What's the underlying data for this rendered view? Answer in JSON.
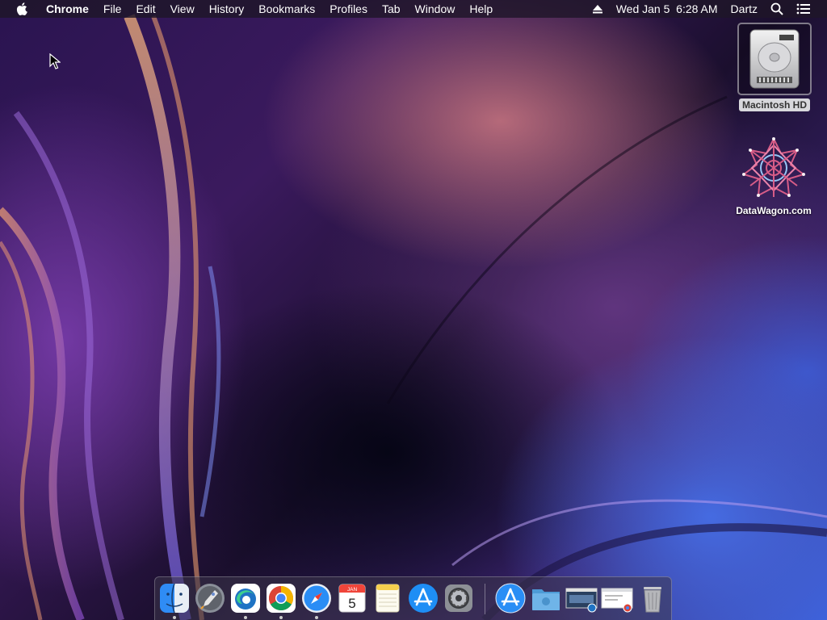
{
  "menubar": {
    "apple_icon": "apple-icon",
    "app_name": "Chrome",
    "menus": [
      "File",
      "Edit",
      "View",
      "History",
      "Bookmarks",
      "Profiles",
      "Tab",
      "Window",
      "Help"
    ],
    "clock": "Wed Jan 5  6:28 AM",
    "user": "Dartz",
    "eject_icon": "eject-icon",
    "search_icon": "spotlight-search-icon",
    "notification_icon": "notification-center-icon"
  },
  "desktop": {
    "icons": [
      {
        "label": "Macintosh HD",
        "icon": "hard-drive-icon",
        "selected": true
      },
      {
        "label": "DataWagon.com",
        "icon": "datawagon-logo-icon"
      }
    ]
  },
  "dock": {
    "apps": [
      {
        "name": "finder-icon",
        "running": true
      },
      {
        "name": "launchpad-icon",
        "running": false
      },
      {
        "name": "edge-icon",
        "running": true
      },
      {
        "name": "chrome-icon",
        "running": true
      },
      {
        "name": "safari-icon",
        "running": true
      },
      {
        "name": "calendar-icon",
        "running": false,
        "month": "JAN",
        "day": "5"
      },
      {
        "name": "notes-icon",
        "running": false
      },
      {
        "name": "app-store-icon",
        "running": false
      },
      {
        "name": "system-preferences-icon",
        "running": false
      }
    ],
    "others": [
      {
        "name": "app-store-download-icon"
      },
      {
        "name": "folder-icon"
      },
      {
        "name": "edge-window-thumbnail-icon"
      },
      {
        "name": "chrome-window-thumbnail-icon"
      },
      {
        "name": "trash-icon"
      }
    ]
  },
  "colors": {
    "menubar_bg": "#1e1628",
    "selection_label_bg": "#d8d8dc",
    "accent_blue": "#2f8cf5"
  }
}
